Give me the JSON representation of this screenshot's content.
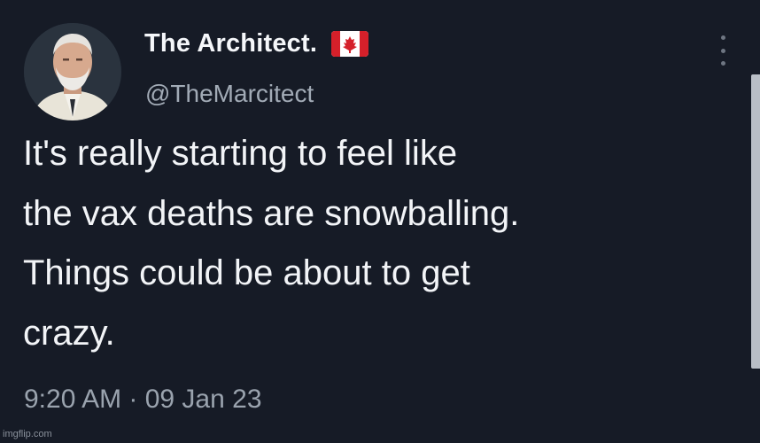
{
  "author": {
    "display_name": "The Architect.",
    "handle": "@TheMarcitect",
    "badge_icon": "canada-flag-icon"
  },
  "tweet": {
    "text_lines": [
      "It's really starting to feel like",
      "the vax deaths are snowballing.",
      "Things could be about to get",
      "crazy."
    ],
    "timestamp": "9:20 AM · 09 Jan 23"
  },
  "menu": {
    "icon": "more-vertical-icon"
  },
  "watermark": "imgflip.com",
  "colors": {
    "background": "#161b26",
    "text": "#f2f4f7",
    "secondary_text": "#9aa3ae",
    "flag_red": "#d5202a"
  }
}
